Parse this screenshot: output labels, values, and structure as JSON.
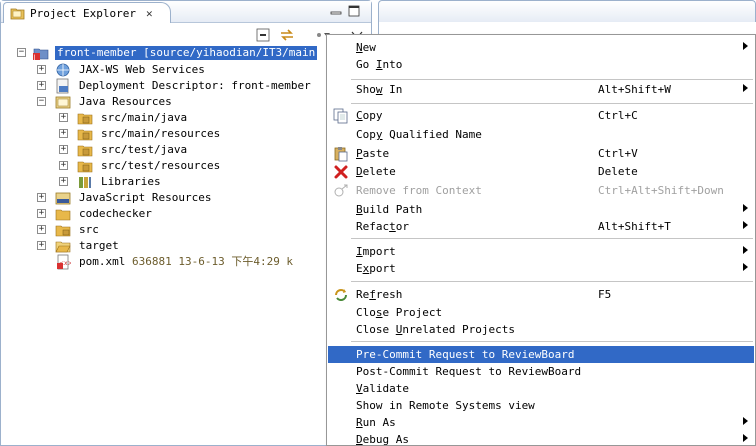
{
  "view": {
    "title": "Project Explorer",
    "close_glyph": "✕"
  },
  "tree": {
    "project": {
      "name": "front-member",
      "decoration": "[source/yihaodian/IT3/main"
    },
    "items": [
      {
        "label": "JAX-WS Web Services",
        "icon": "web-services-icon"
      },
      {
        "label": "Deployment Descriptor: front-member",
        "icon": "deployment-descriptor-icon"
      },
      {
        "label": "Java Resources",
        "icon": "java-resources-icon"
      },
      {
        "label": "src/main/java",
        "icon": "source-folder-icon"
      },
      {
        "label": "src/main/resources",
        "icon": "source-folder-icon"
      },
      {
        "label": "src/test/java",
        "icon": "source-folder-icon"
      },
      {
        "label": "src/test/resources",
        "icon": "source-folder-icon"
      },
      {
        "label": "Libraries",
        "icon": "libraries-icon"
      },
      {
        "label": "JavaScript Resources",
        "icon": "javascript-resources-icon"
      },
      {
        "label": "codechecker",
        "icon": "folder-icon"
      },
      {
        "label": "src",
        "icon": "folder-icon"
      },
      {
        "label": "target",
        "icon": "folder-icon"
      },
      {
        "label": "pom.xml",
        "icon": "xml-file-icon",
        "decoration": "636881  13-6-13 下午4:29  k"
      }
    ]
  },
  "menu": {
    "items": [
      {
        "label": "New",
        "mnemonic": "N",
        "rest": "ew",
        "shortcut": "",
        "submenu": true
      },
      {
        "label": "Go Into",
        "pre": "Go ",
        "mnemonic": "I",
        "rest": "nto",
        "shortcut": "",
        "submenu": false
      },
      {
        "label": "Show In",
        "pre": "Sho",
        "mnemonic": "w",
        "rest": " In",
        "shortcut": "Alt+Shift+W",
        "submenu": true
      },
      {
        "label": "Copy",
        "mnemonic": "C",
        "rest": "opy",
        "shortcut": "Ctrl+C",
        "submenu": false
      },
      {
        "label": "Copy Qualified Name",
        "pre": "Cop",
        "mnemonic": "y",
        "rest": " Qualified Name",
        "shortcut": "",
        "submenu": false
      },
      {
        "label": "Paste",
        "mnemonic": "P",
        "rest": "aste",
        "shortcut": "Ctrl+V",
        "submenu": false
      },
      {
        "label": "Delete",
        "mnemonic": "D",
        "rest": "elete",
        "shortcut": "Delete",
        "submenu": false
      },
      {
        "label": "Remove from Context",
        "shortcut": "Ctrl+Alt+Shift+Down",
        "submenu": false,
        "disabled": true
      },
      {
        "label": "Build Path",
        "mnemonic": "B",
        "rest": "uild Path",
        "shortcut": "",
        "submenu": true
      },
      {
        "label": "Refactor",
        "pre": "Refac",
        "mnemonic": "t",
        "rest": "or",
        "shortcut": "Alt+Shift+T",
        "submenu": true
      },
      {
        "label": "Import",
        "mnemonic": "I",
        "rest": "mport",
        "shortcut": "",
        "submenu": true
      },
      {
        "label": "Export",
        "pre": "E",
        "mnemonic": "x",
        "rest": "port",
        "shortcut": "",
        "submenu": true
      },
      {
        "label": "Refresh",
        "pre": "Re",
        "mnemonic": "f",
        "rest": "resh",
        "shortcut": "F5",
        "submenu": false
      },
      {
        "label": "Close Project",
        "pre": "Clo",
        "mnemonic": "s",
        "rest": "e Project",
        "shortcut": "",
        "submenu": false
      },
      {
        "label": "Close Unrelated Projects",
        "pre": "Close ",
        "mnemonic": "U",
        "rest": "nrelated Projects",
        "shortcut": "",
        "submenu": false
      },
      {
        "label": "Pre-Commit Request to ReviewBoard",
        "shortcut": "",
        "submenu": false,
        "highlighted": true
      },
      {
        "label": "Post-Commit Request to ReviewBoard",
        "shortcut": "",
        "submenu": false
      },
      {
        "label": "Validate",
        "mnemonic": "V",
        "rest": "alidate",
        "shortcut": "",
        "submenu": false
      },
      {
        "label": "Show in Remote Systems view",
        "shortcut": "",
        "submenu": false
      },
      {
        "label": "Run As",
        "mnemonic": "R",
        "rest": "un As",
        "shortcut": "",
        "submenu": true
      },
      {
        "label": "Debug As",
        "mnemonic": "D",
        "rest": "ebug As",
        "shortcut": "",
        "submenu": true
      }
    ]
  },
  "colors": {
    "selection": "#3169c6",
    "border": "#9cb1cc"
  }
}
